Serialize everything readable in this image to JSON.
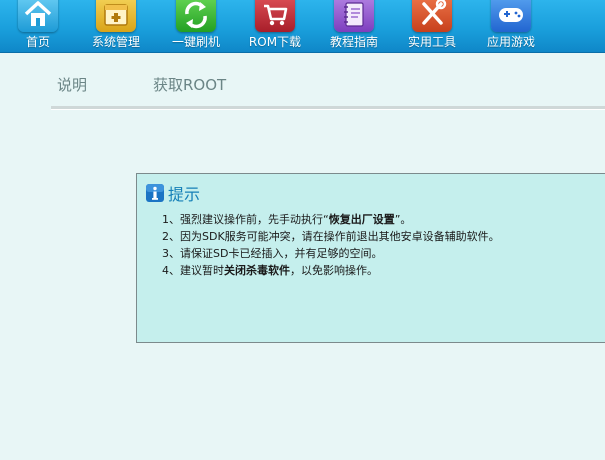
{
  "toolbar": {
    "items": [
      {
        "label": "首页",
        "icon": "home-icon"
      },
      {
        "label": "系统管理",
        "icon": "system-manage-icon"
      },
      {
        "label": "一键刷机",
        "icon": "refresh-flash-icon"
      },
      {
        "label": "ROM下载",
        "icon": "shopping-cart-icon"
      },
      {
        "label": "教程指南",
        "icon": "notebook-icon"
      },
      {
        "label": "实用工具",
        "icon": "tools-icon"
      },
      {
        "label": "应用游戏",
        "icon": "gamepad-icon"
      }
    ]
  },
  "subtabs": {
    "items": [
      {
        "label": "说明"
      },
      {
        "label": "获取ROOT"
      }
    ]
  },
  "notice": {
    "title": "提示",
    "icon": "info-icon",
    "items": [
      {
        "prefix": "1、强烈建议操作前，先手动执行“",
        "bold": "恢复出厂设置",
        "suffix": "”。"
      },
      {
        "prefix": "2、因为SDK服务可能冲突，请在操作前退出其他安卓设备辅助软件。",
        "bold": "",
        "suffix": ""
      },
      {
        "prefix": "3、请保证SD卡已经插入，并有足够的空间。",
        "bold": "",
        "suffix": ""
      },
      {
        "prefix": "4、建议暂时",
        "bold": "关闭杀毒软件",
        "suffix": "，以免影响操作。"
      }
    ]
  },
  "colors": {
    "toolbar_bg": "#1a9fdc",
    "page_bg": "#e8f6f6",
    "notice_bg": "#c5efed",
    "notice_title": "#1680b8",
    "subtab_text": "#6b8586"
  }
}
